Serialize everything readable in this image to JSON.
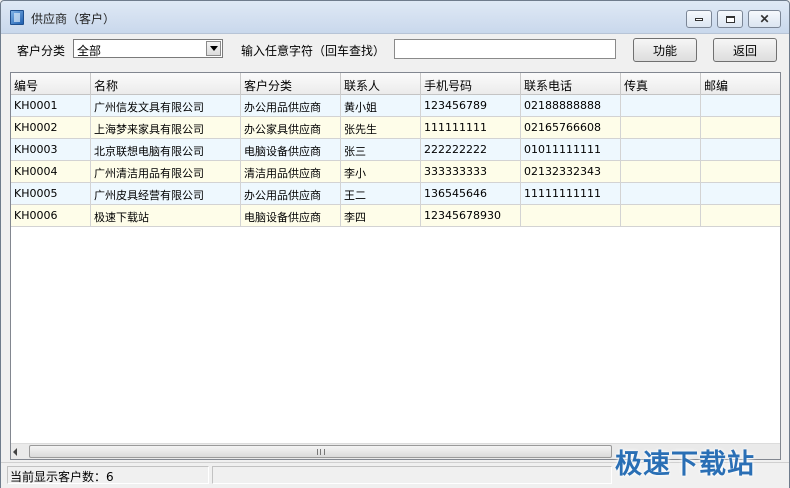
{
  "window": {
    "title": "供应商（客户）",
    "icon": "app-book-icon"
  },
  "toolbar": {
    "category_label": "客户分类",
    "category_value": "全部",
    "search_label": "输入任意字符（回车查找）",
    "search_value": "",
    "function_button": "功能",
    "back_button": "返回"
  },
  "table": {
    "columns": [
      "编号",
      "名称",
      "客户分类",
      "联系人",
      "手机号码",
      "联系电话",
      "传真",
      "邮编"
    ],
    "rows": [
      [
        "KH0001",
        "广州信发文具有限公司",
        "办公用品供应商",
        "黄小姐",
        "123456789",
        "02188888888",
        "",
        ""
      ],
      [
        "KH0002",
        "上海梦来家具有限公司",
        "办公家具供应商",
        "张先生",
        "111111111",
        "02165766608",
        "",
        ""
      ],
      [
        "KH0003",
        "北京联想电脑有限公司",
        "电脑设备供应商",
        "张三",
        "222222222",
        "01011111111",
        "",
        ""
      ],
      [
        "KH0004",
        "广州清洁用品有限公司",
        "清洁用品供应商",
        "李小",
        "333333333",
        "02132332343",
        "",
        ""
      ],
      [
        "KH0005",
        "广州皮具经营有限公司",
        "办公用品供应商",
        "王二",
        "136545646",
        "11111111111",
        "",
        ""
      ],
      [
        "KH0006",
        "极速下载站",
        "电脑设备供应商",
        "李四",
        "12345678930",
        "",
        "",
        ""
      ]
    ]
  },
  "status": {
    "text": "当前显示客户数：6"
  },
  "watermark": "极速下载站",
  "colors": {
    "row_odd": "#eef8fe",
    "row_even": "#fefde9",
    "watermark": "#2a6fb5"
  }
}
